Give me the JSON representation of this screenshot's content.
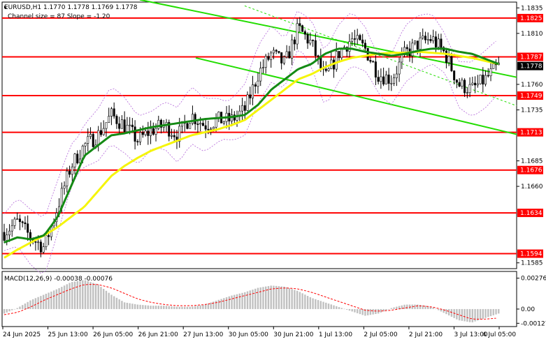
{
  "header": {
    "symbol_line": "EURUSD,H1  1.1770 1.1778 1.1769 1.1778",
    "channel_line": "Channel size = 87 Slope = -1.20"
  },
  "macd": {
    "label": "MACD(12,26,9) -0.00038 -0.00076"
  },
  "colors": {
    "level_line": "#ff0000",
    "level_tag_bg": "#ff0000",
    "current_tag_bg": "#000000",
    "channel": "#22dd00",
    "ma_fast": "#148a14",
    "ma_slow": "#f5f50a",
    "envelope": "#b366d9",
    "candle": "#000000",
    "macd_hist": "#c0c0c0",
    "macd_signal": "#ff0000"
  },
  "chart_data": {
    "type": "candlestick",
    "price_ylim": [
      1.158,
      1.184
    ],
    "price_ticks": [
      "1.1835",
      "1.1810",
      "1.1760",
      "1.1735",
      "1.1685",
      "1.1660",
      "1.1585"
    ],
    "levels": [
      "1.1825",
      "1.1787",
      "1.1749",
      "1.1713",
      "1.1676",
      "1.1634",
      "1.1594"
    ],
    "current_price": "1.1778",
    "x_labels": [
      "24 Jun 2025",
      "25 Jun 13:00",
      "26 Jun 05:00",
      "26 Jun 21:00",
      "27 Jun 13:00",
      "30 Jun 05:00",
      "30 Jun 21:00",
      "1 Jul 13:00",
      "2 Jul 05:00",
      "2 Jul 21:00",
      "3 Jul 13:00",
      "4 Jul 05:00"
    ],
    "close_anchors": [
      1.1615,
      1.1625,
      1.161,
      1.16,
      1.164,
      1.168,
      1.17,
      1.171,
      1.173,
      1.172,
      1.1705,
      1.1715,
      1.172,
      1.171,
      1.173,
      1.172,
      1.1725,
      1.1725,
      1.1735,
      1.177,
      1.179,
      1.178,
      1.1815,
      1.18,
      1.1765,
      1.179,
      1.1805,
      1.1795,
      1.177,
      1.1765,
      1.179,
      1.18,
      1.1805,
      1.179,
      1.176,
      1.1755,
      1.1765,
      1.1778
    ],
    "ma_fast_anchors": [
      1.1605,
      1.161,
      1.1608,
      1.1612,
      1.163,
      1.166,
      1.169,
      1.17,
      1.171,
      1.1712,
      1.1715,
      1.1718,
      1.172,
      1.1722,
      1.1724,
      1.1726,
      1.1727,
      1.1728,
      1.173,
      1.174,
      1.1755,
      1.1765,
      1.1775,
      1.178,
      1.179,
      1.1795,
      1.1795,
      1.1792,
      1.179,
      1.1788,
      1.179,
      1.1793,
      1.1795,
      1.1795,
      1.1792,
      1.179,
      1.1785,
      1.178
    ],
    "ma_slow_anchors": [
      1.159,
      1.1598,
      1.1605,
      1.1612,
      1.162,
      1.163,
      1.164,
      1.1655,
      1.167,
      1.168,
      1.1688,
      1.1695,
      1.17,
      1.1705,
      1.171,
      1.1713,
      1.1716,
      1.172,
      1.1725,
      1.1735,
      1.1745,
      1.1755,
      1.1765,
      1.177,
      1.1777,
      1.1782,
      1.1786,
      1.1788,
      1.179,
      1.1791,
      1.1791,
      1.1792,
      1.1791,
      1.179,
      1.1788,
      1.1786,
      1.1783,
      1.178
    ],
    "channel": {
      "upper": [
        1.1843,
        1.1767
      ],
      "lower": [
        1.1786,
        1.1711
      ]
    },
    "macd_ylim": [
      -0.0015,
      0.0033
    ],
    "macd_ticks": [
      "0.00276",
      "0.00",
      "-0.00127"
    ],
    "macd_values": [
      -0.0004,
      0.0001,
      0.0008,
      0.0013,
      0.0018,
      0.0024,
      0.0026,
      0.0022,
      0.0013,
      0.0006,
      0.0004,
      0.0003,
      0.0003,
      0.0002,
      0.0002,
      0.0004,
      0.0008,
      0.0012,
      0.0015,
      0.0019,
      0.0021,
      0.002,
      0.0016,
      0.001,
      0.0006,
      0.0002,
      -0.0002,
      -0.0006,
      -0.0004,
      0.0001,
      0.0004,
      0.0004,
      0.0002,
      -0.0004,
      -0.001,
      -0.0012,
      -0.0008,
      -0.0004
    ],
    "macd_signal": [
      -0.0005,
      -0.0003,
      0.0002,
      0.0008,
      0.0013,
      0.0018,
      0.0022,
      0.0022,
      0.0019,
      0.0014,
      0.0009,
      0.0006,
      0.0004,
      0.0003,
      0.0003,
      0.0004,
      0.0006,
      0.0009,
      0.0012,
      0.0015,
      0.0018,
      0.0019,
      0.0018,
      0.0015,
      0.0011,
      0.0007,
      0.0003,
      -0.0001,
      -0.0002,
      -0.0001,
      0.0001,
      0.0003,
      0.0002,
      -0.0001,
      -0.0005,
      -0.0009,
      -0.0009,
      -0.0008
    ]
  }
}
